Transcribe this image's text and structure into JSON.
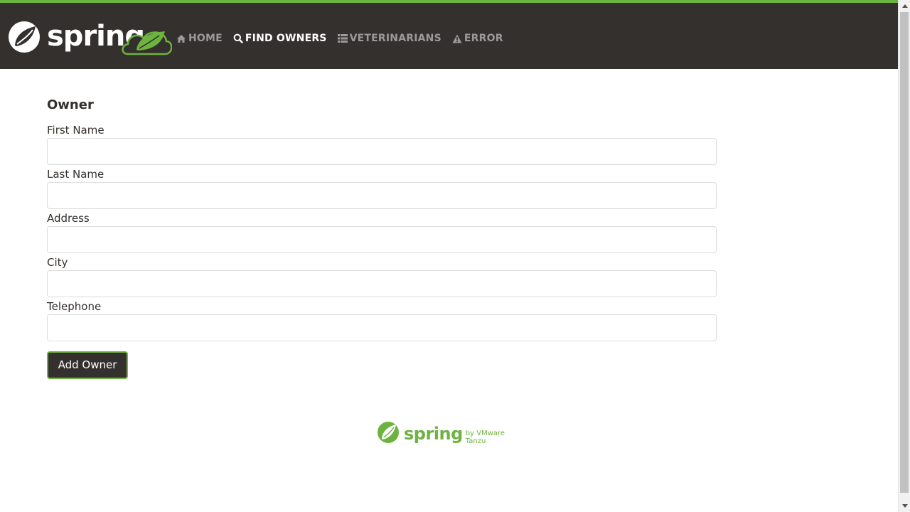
{
  "nav": {
    "brand": {
      "word": "spring"
    },
    "items": [
      {
        "label": "HOME",
        "icon": "home-icon",
        "active": false
      },
      {
        "label": "FIND OWNERS",
        "icon": "search-icon",
        "active": true
      },
      {
        "label": "VETERINARIANS",
        "icon": "list-icon",
        "active": false
      },
      {
        "label": "ERROR",
        "icon": "warning-icon",
        "active": false
      }
    ]
  },
  "form": {
    "title": "Owner",
    "fields": [
      {
        "label": "First Name",
        "value": ""
      },
      {
        "label": "Last Name",
        "value": ""
      },
      {
        "label": "Address",
        "value": ""
      },
      {
        "label": "City",
        "value": ""
      },
      {
        "label": "Telephone",
        "value": ""
      }
    ],
    "submit_label": "Add Owner"
  },
  "footer": {
    "word": "spring",
    "by": "by VMware Tanzu"
  },
  "colors": {
    "nav_bg": "#34302d",
    "accent": "#6db33f",
    "nav_inactive": "#9b9a98",
    "nav_active": "#ffffff"
  }
}
